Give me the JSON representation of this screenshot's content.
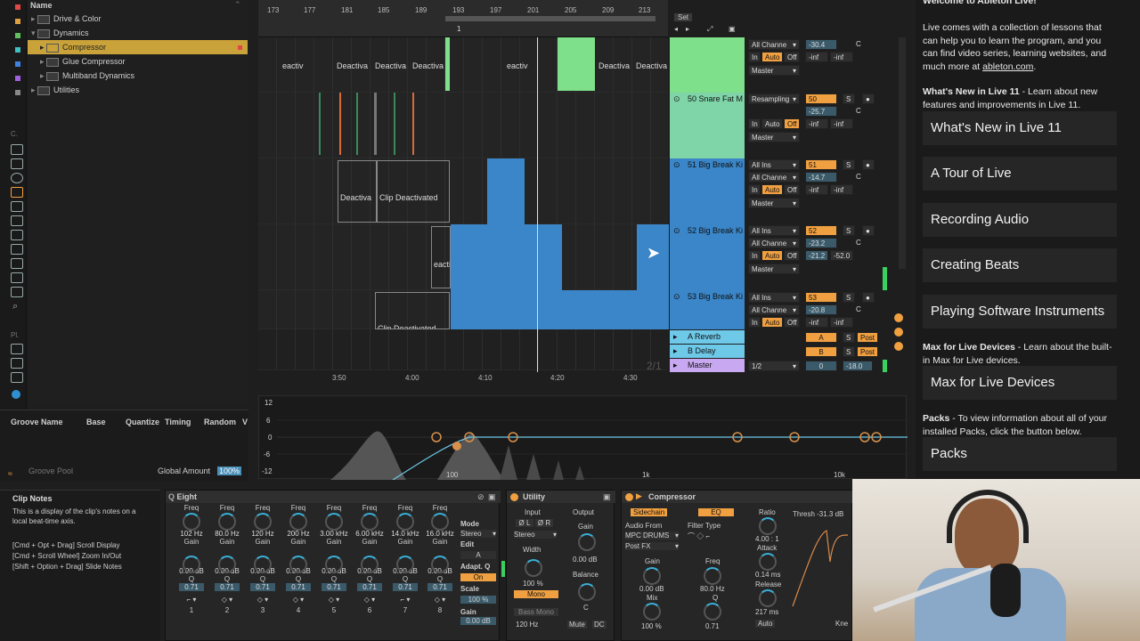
{
  "browser": {
    "header": "Name",
    "items": [
      {
        "label": "Drive & Color",
        "level": 1
      },
      {
        "label": "Dynamics",
        "level": 1
      },
      {
        "label": "Compressor",
        "level": 2,
        "selected": true
      },
      {
        "label": "Glue Compressor",
        "level": 2
      },
      {
        "label": "Multiband Dynamics",
        "level": 2
      },
      {
        "label": "Utilities",
        "level": 1
      }
    ]
  },
  "groove": {
    "cols": [
      "Groove Name",
      "Base",
      "Quantize",
      "Timing",
      "Random",
      "V"
    ],
    "pool_label": "Groove Pool",
    "global_amount_label": "Global Amount",
    "global_amount_value": "100%"
  },
  "ruler": {
    "bars": [
      "173",
      "177",
      "181",
      "185",
      "189",
      "193",
      "197",
      "201",
      "205",
      "209",
      "213"
    ],
    "marker": "1",
    "set_label": "Set",
    "times": [
      "3:50",
      "4:00",
      "4:10",
      "4:20",
      "4:30"
    ],
    "page": "2/1"
  },
  "clips": {
    "deactivated": "Deactiv",
    "deactivated_full": "Clip Deactivated",
    "deactivated_cut": "Deactiva",
    "deacti": "eacti",
    "deactiv_cut": "eactiv",
    "clip_deact_bottom": "Clip Deactivated"
  },
  "tracks": [
    {
      "name": "",
      "input": "All Channe",
      "routing": "Master",
      "num": "",
      "vol": "-30.4",
      "pan": "C",
      "send1": "-inf",
      "send2": "-inf",
      "color": "#7ee08a"
    },
    {
      "name": "50 Snare Fat M",
      "input": "Resampling",
      "routing": "Master",
      "num": "50",
      "vol": "-25.7",
      "pan": "C",
      "send1": "-inf",
      "send2": "-inf",
      "color": "#7ee08a"
    },
    {
      "name": "51 Big Break Ki",
      "input": "All Ins",
      "channel": "All Channe",
      "routing": "Master",
      "num": "51",
      "vol": "-14.7",
      "pan": "C",
      "send1": "-inf",
      "send2": "-inf",
      "color": "#3a86c8"
    },
    {
      "name": "52 Big Break Ki",
      "input": "All Ins",
      "channel": "All Channe",
      "routing": "Master",
      "num": "52",
      "vol": "-23.2",
      "pan": "C",
      "send1": "-21.2",
      "send2": "-52.0",
      "color": "#3a86c8"
    },
    {
      "name": "53 Big Break Ki",
      "input": "All Ins",
      "channel": "All Channe",
      "routing": "",
      "num": "53",
      "vol": "-20.8",
      "pan": "C",
      "send1": "-inf",
      "send2": "-inf",
      "color": "#3a86c8"
    }
  ],
  "mixer_labels": {
    "in": "In",
    "auto": "Auto",
    "off": "Off",
    "s": "S",
    "post": "Post"
  },
  "returns": [
    {
      "name": "A Reverb",
      "letter": "A"
    },
    {
      "name": "B Delay",
      "letter": "B"
    },
    {
      "name": "Master",
      "route": "1/2",
      "num": "0",
      "vol": "-18.0"
    }
  ],
  "eq_scale": {
    "db": [
      "12",
      "6",
      "0",
      "-6",
      "-12"
    ],
    "freq": [
      "100",
      "1k",
      "10k"
    ]
  },
  "clip_notes": {
    "title": "Clip Notes",
    "line1": "This is a display of the clip's notes on a local beat-time axis.",
    "line2": "[Cmd + Opt + Drag] Scroll Display",
    "line3": "[Cmd + Scroll Wheel] Zoom In/Out",
    "line4": "[Shift + Option + Drag] Slide Notes"
  },
  "eq8": {
    "title": "Eight",
    "freq_label": "Freq",
    "gain_label": "Gain",
    "q_label": "Q",
    "bands": [
      {
        "freq": "102 Hz",
        "gain": "0.00 dB",
        "q": "0.71",
        "n": "1"
      },
      {
        "freq": "80.0 Hz",
        "gain": "0.00 dB",
        "q": "0.71",
        "n": "2"
      },
      {
        "freq": "120 Hz",
        "gain": "0.00 dB",
        "q": "0.71",
        "n": "3"
      },
      {
        "freq": "200 Hz",
        "gain": "0.00 dB",
        "q": "0.71",
        "n": "4"
      },
      {
        "freq": "3.00 kHz",
        "gain": "0.00 dB",
        "q": "0.71",
        "n": "5"
      },
      {
        "freq": "6.00 kHz",
        "gain": "0.00 dB",
        "q": "0.71",
        "n": "6"
      },
      {
        "freq": "14.0 kHz",
        "gain": "0.00 dB",
        "q": "0.71",
        "n": "7"
      },
      {
        "freq": "16.0 kHz",
        "gain": "0.00 dB",
        "q": "0.71",
        "n": "8"
      }
    ],
    "mode_label": "Mode",
    "mode_value": "Stereo",
    "edit_label": "Edit",
    "edit_value": "A",
    "adapt_label": "Adapt. Q",
    "adapt_value": "On",
    "scale_label": "Scale",
    "scale_value": "100 %",
    "gain_label2": "Gain",
    "gain_value": "0.00 dB"
  },
  "utility": {
    "title": "Utility",
    "input": "Input",
    "output": "Output",
    "phase_l": "Ø L",
    "phase_r": "Ø R",
    "stereo": "Stereo",
    "width": "Width",
    "width_val": "100 %",
    "mono": "Mono",
    "bass_mono": "Bass Mono",
    "bass_freq": "120 Hz",
    "gain": "Gain",
    "gain_val": "0.00 dB",
    "balance": "Balance",
    "balance_val": "C",
    "mute": "Mute",
    "dc": "DC"
  },
  "compressor": {
    "title": "Compressor",
    "sidechain": "Sidechain",
    "eq": "EQ",
    "audio_from": "Audio From",
    "source": "MPC DRUMS",
    "post_fx": "Post FX",
    "filter_type": "Filter Type",
    "gain": "Gain",
    "gain_val": "0.00 dB",
    "freq": "Freq",
    "freq_val": "80.0 Hz",
    "mix": "Mix",
    "mix_val": "100 %",
    "q": "Q",
    "q_val": "0.71",
    "ratio": "Ratio",
    "ratio_val": "4.00 : 1",
    "attack": "Attack",
    "attack_val": "0.14 ms",
    "release": "Release",
    "release_val": "217 ms",
    "auto": "Auto",
    "thresh": "Thresh",
    "thresh_val": "-31.3 dB",
    "knee": "Kne"
  },
  "help": {
    "title": "Welcome to Ableton Live!",
    "intro": "Live comes with a collection of lessons that can help you to learn the program, and you can find video series, learning websites, and much more at ",
    "intro_link": "ableton.com",
    "whats_new_lead": "What's New in Live 11",
    "whats_new_text": " - Learn about new features and improvements in Live 11.",
    "lessons": [
      "What's New in Live 11",
      "A Tour of Live",
      "Recording Audio",
      "Creating Beats",
      "Playing Software Instruments"
    ],
    "m4l_lead": "Max for Live Devices",
    "m4l_text": " - Learn about the built-in Max for Live devices.",
    "m4l_btn": "Max for Live Devices",
    "packs_lead": "Packs",
    "packs_text": " - To view information about all of your installed Packs, click the button below.",
    "packs_btn": "Packs"
  },
  "sidebar_letters": {
    "c": "C.",
    "pl": "Pl."
  }
}
